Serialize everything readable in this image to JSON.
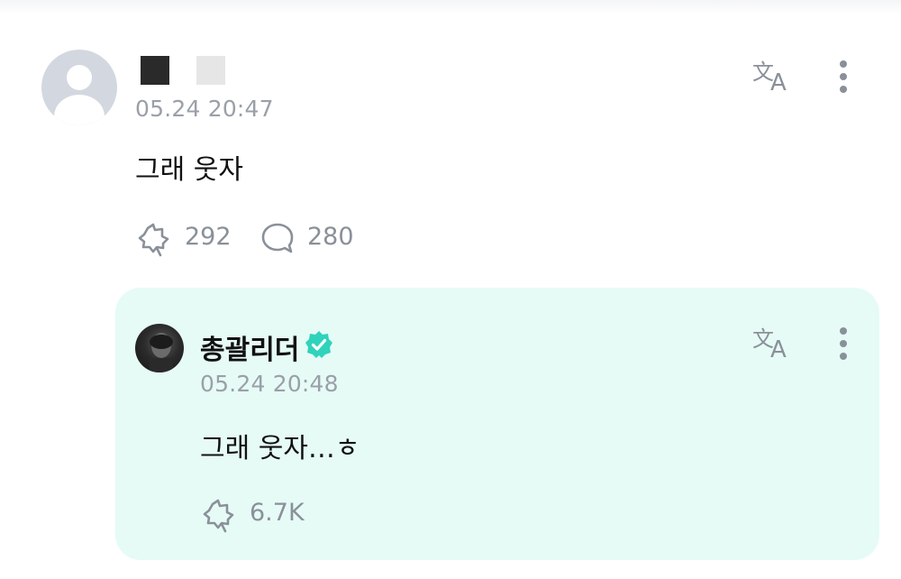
{
  "comment": {
    "timestamp": "05.24 20:47",
    "text": "그래 웃자",
    "likes": "292",
    "replies": "280"
  },
  "reply": {
    "author": "총괄리더",
    "verified": true,
    "timestamp": "05.24 20:48",
    "text": "그래 웃자…ㅎ",
    "likes": "6.7K"
  },
  "icons": {
    "translate": "translate-icon",
    "more": "more-vertical-icon",
    "like": "like-icon",
    "reply": "reply-icon",
    "verified": "verified-badge-icon"
  },
  "colors": {
    "reply_background": "#e6fbf6",
    "verified_badge": "#2fd3bc",
    "meta_text": "#9aa0a8"
  }
}
